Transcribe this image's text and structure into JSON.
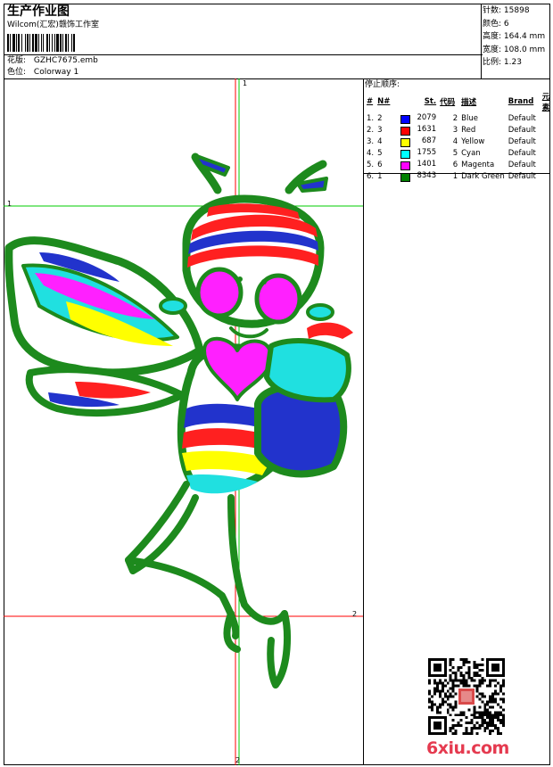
{
  "header": {
    "title": "生产作业图",
    "software": "Wilcom(汇宏)赣饰工作室",
    "design_label": "花版:",
    "design_file": "GZHC7675.emb",
    "colorway_label": "色位:",
    "colorway": "Colorway 1"
  },
  "specs": [
    {
      "label": "针数:",
      "value": "15898"
    },
    {
      "label": "颜色:",
      "value": "6"
    },
    {
      "label": "高度:",
      "value": "164.4 mm"
    },
    {
      "label": "宽度:",
      "value": "108.0 mm"
    },
    {
      "label": "比例:",
      "value": "1.23"
    }
  ],
  "stop_table": {
    "title": "停止顺序:",
    "columns": [
      "#",
      "N#",
      "St.",
      "代码",
      "描述",
      "Brand",
      "元素"
    ],
    "rows": [
      {
        "idx": "1.",
        "n": "2",
        "st": "2079",
        "code": "2",
        "desc": "Blue",
        "brand": "Default",
        "color": "#0000ff"
      },
      {
        "idx": "2.",
        "n": "3",
        "st": "1631",
        "code": "3",
        "desc": "Red",
        "brand": "Default",
        "color": "#ff0000"
      },
      {
        "idx": "3.",
        "n": "4",
        "st": "687",
        "code": "4",
        "desc": "Yellow",
        "brand": "Default",
        "color": "#ffff00"
      },
      {
        "idx": "4.",
        "n": "5",
        "st": "1755",
        "code": "5",
        "desc": "Cyan",
        "brand": "Default",
        "color": "#00ffff"
      },
      {
        "idx": "5.",
        "n": "6",
        "st": "1401",
        "code": "6",
        "desc": "Magenta",
        "brand": "Default",
        "color": "#ff00ff"
      },
      {
        "idx": "6.",
        "n": "1",
        "st": "8343",
        "code": "1",
        "desc": "Dark Green",
        "brand": "Default",
        "color": "#008000"
      }
    ]
  },
  "axis_labels": {
    "top1": "1",
    "left1": "1",
    "right2": "2",
    "bottom2": "2"
  },
  "watermark": {
    "text": "6xiu",
    "tld": ".com"
  }
}
